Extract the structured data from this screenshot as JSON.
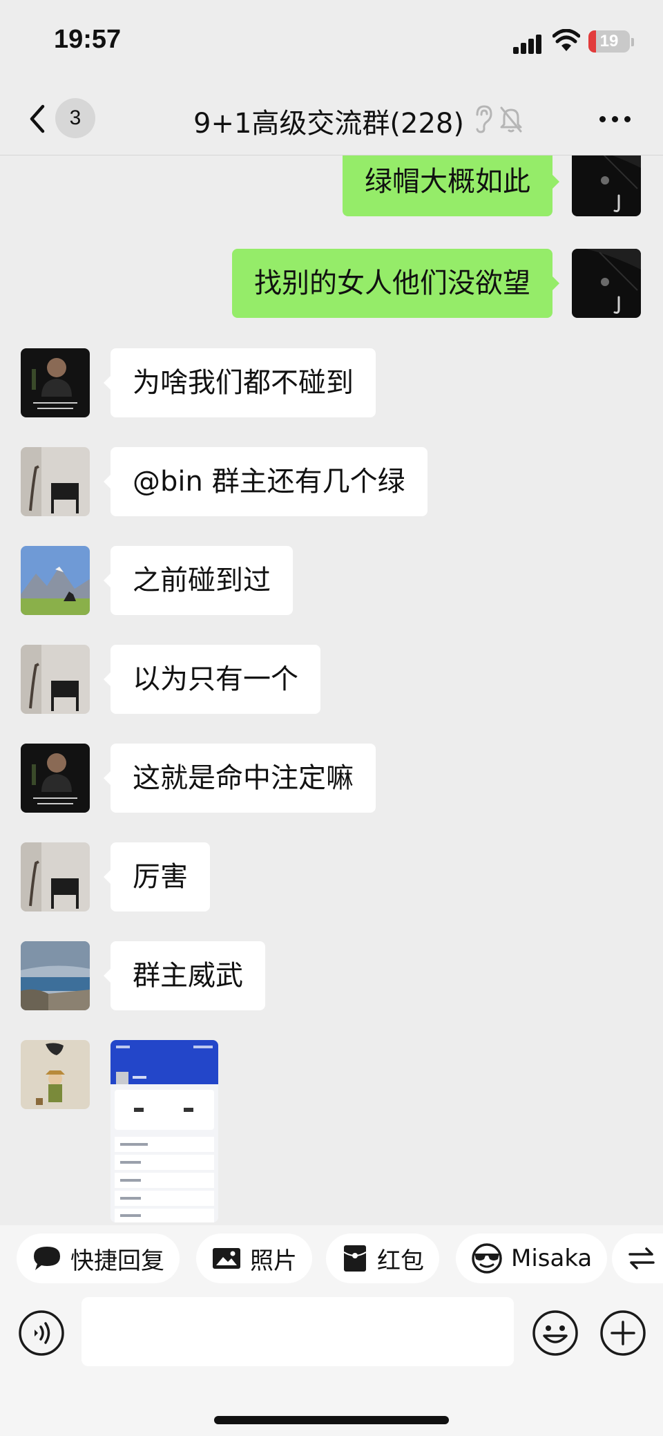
{
  "status_bar": {
    "time": "19:57",
    "battery_level": "19",
    "battery_fraction": 0.19
  },
  "header": {
    "back_icon": "chevron-left-icon",
    "unread_count": "3",
    "title": "9+1高级交流群(228)",
    "icons": [
      "ear-icon",
      "mute-bell-icon",
      "more-icon"
    ]
  },
  "messages": [
    {
      "side": "out",
      "text": "绿帽大概如此",
      "avatar": "umbrella-dark"
    },
    {
      "side": "out",
      "text": "找别的女人他们没欲望",
      "avatar": "umbrella-dark"
    },
    {
      "side": "in",
      "text": "为啥我们都不碰到",
      "avatar": "man-suit"
    },
    {
      "side": "in",
      "text": "@bin 群主还有几个绿",
      "avatar": "chair-room"
    },
    {
      "side": "in",
      "text": "之前碰到过",
      "avatar": "mountain"
    },
    {
      "side": "in",
      "text": "以为只有一个",
      "avatar": "chair-room"
    },
    {
      "side": "in",
      "text": "这就是命中注定嘛",
      "avatar": "man-suit"
    },
    {
      "side": "in",
      "text": "厉害",
      "avatar": "chair-room"
    },
    {
      "side": "in",
      "text": "群主威武",
      "avatar": "lake"
    },
    {
      "side": "in",
      "type": "image",
      "avatar": "cartoon-hat"
    }
  ],
  "quick_bar": [
    {
      "label": "快捷回复",
      "icon": "speech-bubble-icon"
    },
    {
      "label": "照片",
      "icon": "photo-icon"
    },
    {
      "label": "红包",
      "icon": "red-packet-icon"
    },
    {
      "label": "Misaka",
      "icon": "sunglasses-face-icon"
    },
    {
      "label": "",
      "icon": "swap-arrows-icon"
    }
  ],
  "input": {
    "placeholder": "",
    "value": ""
  },
  "colors": {
    "background": "#ededed",
    "outgoing_bubble": "#95ec69",
    "incoming_bubble": "#ffffff",
    "battery_low": "#e23b3b"
  }
}
